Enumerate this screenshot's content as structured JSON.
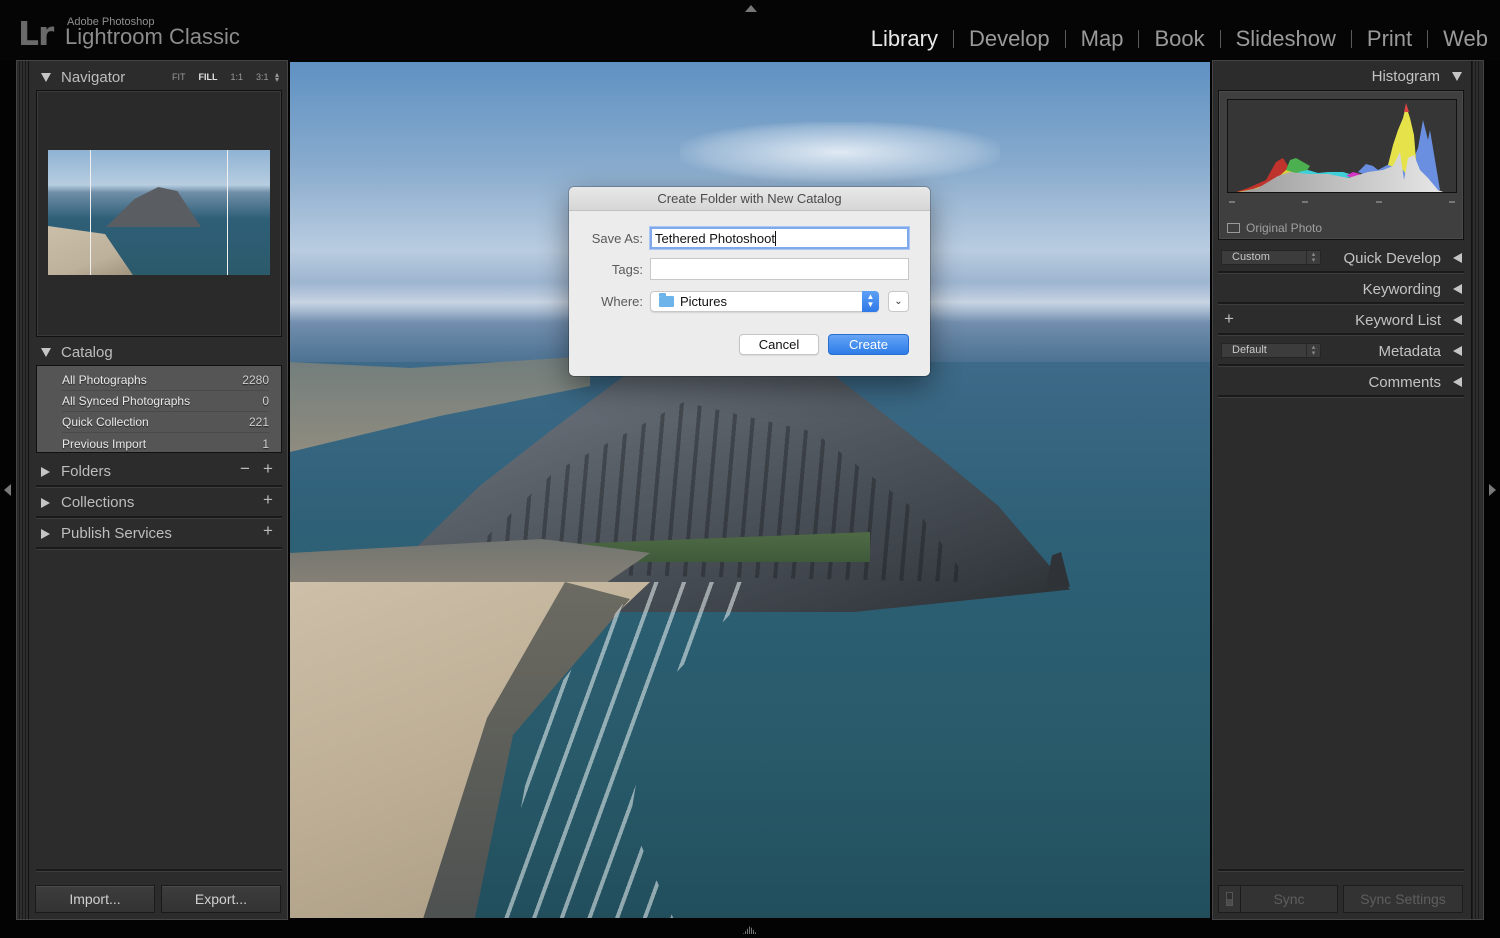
{
  "app": {
    "logo": "Lr",
    "brand_sub": "Adobe Photoshop",
    "brand_main": "Lightroom Classic"
  },
  "modules": [
    {
      "label": "Library",
      "active": true
    },
    {
      "label": "Develop",
      "active": false
    },
    {
      "label": "Map",
      "active": false
    },
    {
      "label": "Book",
      "active": false
    },
    {
      "label": "Slideshow",
      "active": false
    },
    {
      "label": "Print",
      "active": false
    },
    {
      "label": "Web",
      "active": false
    }
  ],
  "left_panel": {
    "navigator": {
      "title": "Navigator",
      "zoom_options": [
        "FIT",
        "FILL",
        "1:1",
        "3:1"
      ],
      "active_zoom": "FILL"
    },
    "catalog": {
      "title": "Catalog",
      "items": [
        {
          "label": "All Photographs",
          "count": "2280"
        },
        {
          "label": "All Synced Photographs",
          "count": "0"
        },
        {
          "label": "Quick Collection",
          "count": "221"
        },
        {
          "label": "Previous Import",
          "count": "1"
        }
      ]
    },
    "folders": {
      "title": "Folders"
    },
    "collections": {
      "title": "Collections"
    },
    "publish_services": {
      "title": "Publish Services"
    },
    "import_label": "Import...",
    "export_label": "Export..."
  },
  "right_panel": {
    "histogram": {
      "title": "Histogram",
      "original_photo_label": "Original Photo"
    },
    "quick_develop": {
      "title": "Quick Develop",
      "preset": "Custom"
    },
    "keywording": {
      "title": "Keywording"
    },
    "keyword_list": {
      "title": "Keyword List"
    },
    "metadata": {
      "title": "Metadata",
      "preset": "Default"
    },
    "comments": {
      "title": "Comments"
    },
    "sync_label": "Sync",
    "sync_settings_label": "Sync Settings"
  },
  "dialog": {
    "title": "Create Folder with New Catalog",
    "save_as_label": "Save As:",
    "save_as_value": "Tethered Photoshoot",
    "tags_label": "Tags:",
    "tags_value": "",
    "where_label": "Where:",
    "where_value": "Pictures",
    "cancel_label": "Cancel",
    "create_label": "Create"
  },
  "colors": {
    "accent_blue": "#2c7ce8",
    "panel_bg": "#2c2c2c",
    "active_module": "#e8e8e8",
    "inactive_module": "#9a9a9a"
  }
}
